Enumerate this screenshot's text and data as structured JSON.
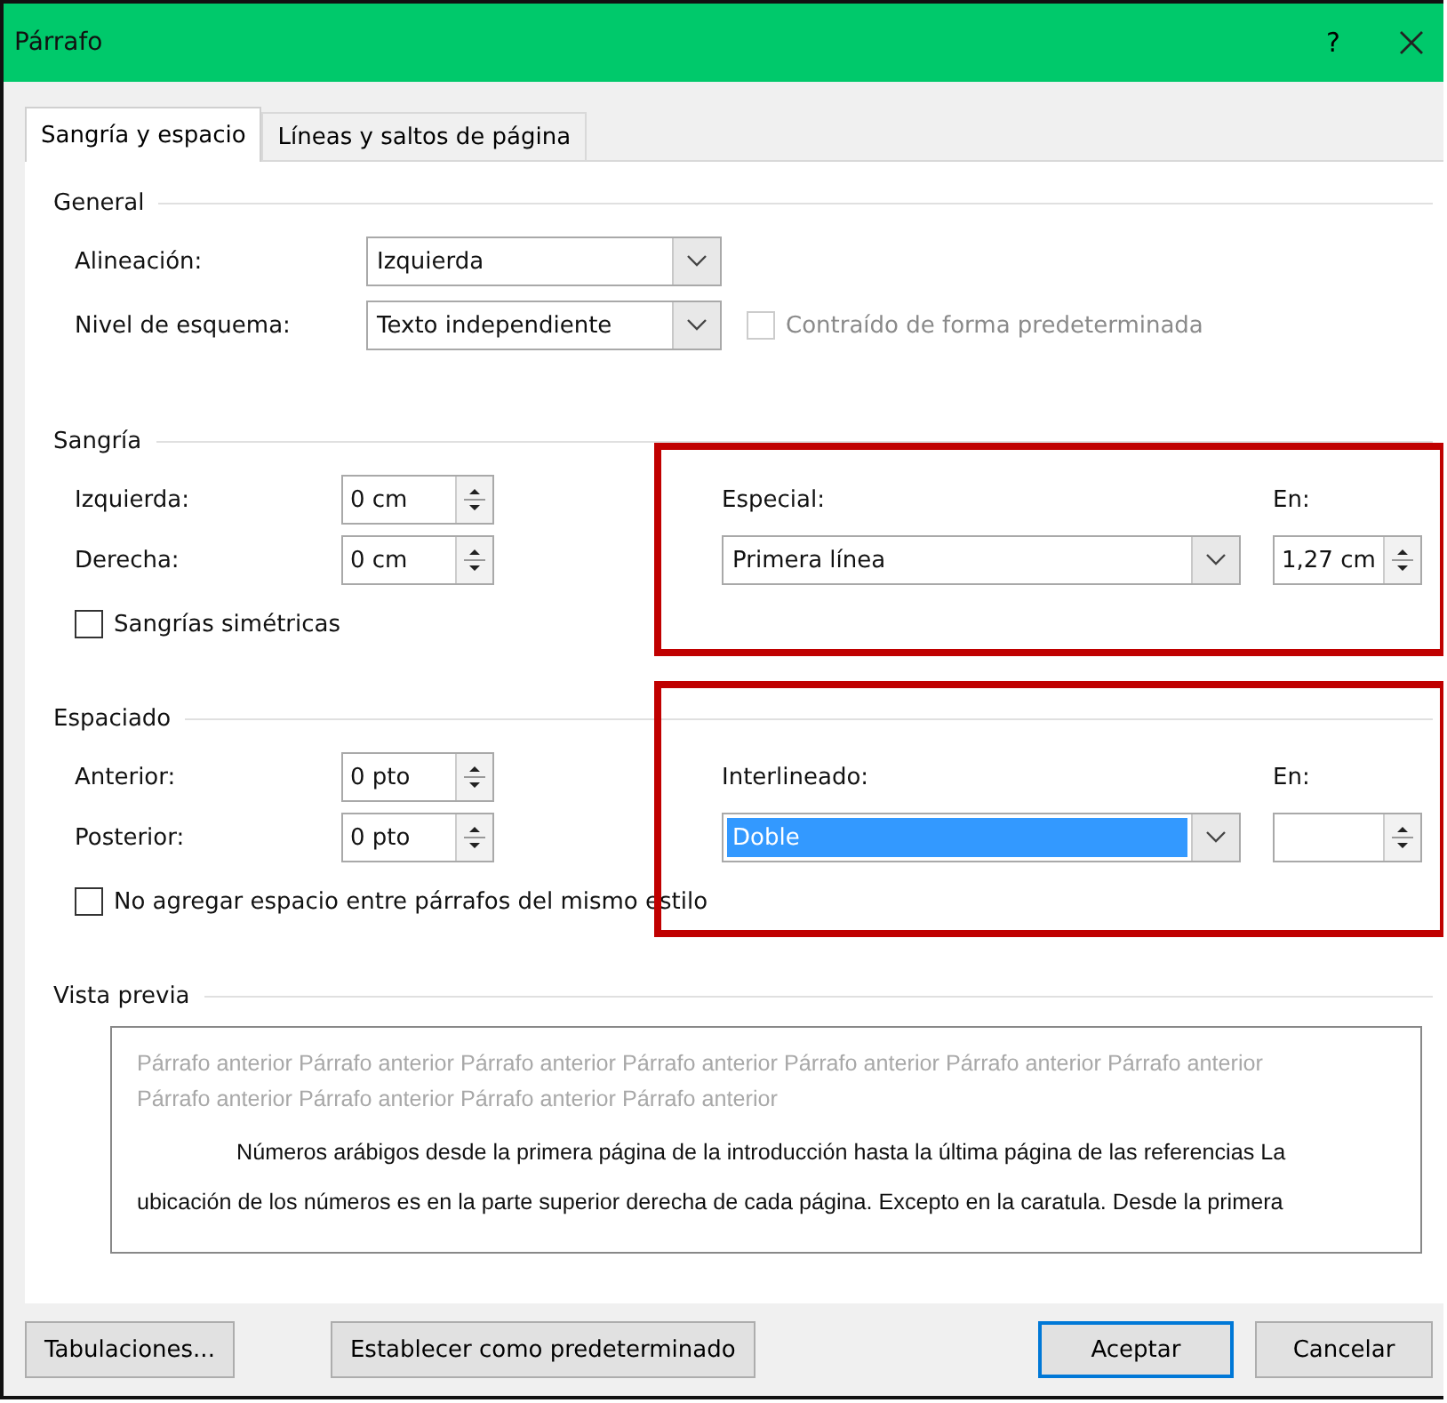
{
  "window": {
    "title": "Párrafo",
    "help": "?"
  },
  "tabs": [
    {
      "label": "Sangría y espacio",
      "selected": true
    },
    {
      "label": "Líneas y saltos de página",
      "selected": false
    }
  ],
  "general": {
    "heading": "General",
    "alignment": {
      "label": "Alineación:",
      "value": "Izquierda"
    },
    "outline_level": {
      "label": "Nivel de esquema:",
      "value": "Texto independiente"
    },
    "collapsed_checkbox": {
      "label": "Contraído de forma predeterminada",
      "checked": false,
      "disabled": true
    }
  },
  "indentation": {
    "heading": "Sangría",
    "highlighted": true,
    "left": {
      "label": "Izquierda:",
      "value": "0 cm"
    },
    "right": {
      "label": "Derecha:",
      "value": "0 cm"
    },
    "special": {
      "label": "Especial:",
      "value": "Primera línea",
      "selected": false
    },
    "by": {
      "label": "En:",
      "value": "1,27 cm"
    },
    "mirror_checkbox": {
      "label": "Sangrías simétricas",
      "checked": false
    }
  },
  "spacing": {
    "heading": "Espaciado",
    "highlighted": true,
    "before": {
      "label": "Anterior:",
      "value": "0 pto"
    },
    "after": {
      "label": "Posterior:",
      "value": "0 pto"
    },
    "line_spacing": {
      "label": "Interlineado:",
      "value": "Doble",
      "selected": true
    },
    "at": {
      "label": "En:"
    },
    "no_space_checkbox": {
      "label": "No agregar espacio entre párrafos del mismo estilo",
      "checked": false
    }
  },
  "preview": {
    "heading": "Vista previa",
    "previous_text": "Párrafo anterior Párrafo anterior Párrafo anterior Párrafo anterior Párrafo anterior Párrafo anterior Párrafo anterior Párrafo anterior Párrafo anterior Párrafo anterior Párrafo anterior",
    "sample_lines": [
      "Números arábigos desde la primera página de la introducción hasta la última página de las referencias La",
      "ubicación de los números es en la parte superior derecha de cada página. Excepto en la caratula. Desde la primera"
    ]
  },
  "buttons": [
    {
      "label": "Tabulaciones...",
      "default": false
    },
    {
      "label": "Establecer como predeterminado",
      "default": false
    },
    {
      "label": "Aceptar",
      "default": true
    },
    {
      "label": "Cancelar",
      "default": false
    }
  ]
}
